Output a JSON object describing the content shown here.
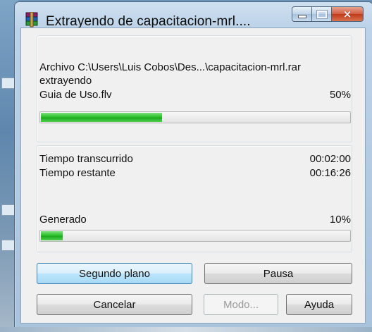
{
  "window": {
    "title": "Extrayendo de capacitacion-mrl....",
    "controls": {
      "minimize": "minimize-icon",
      "maximize": "maximize-icon",
      "close": "×"
    }
  },
  "extract": {
    "archive_line": "Archivo C:\\Users\\Luis Cobos\\Des...\\capacitacion-mrl.rar",
    "action": "extrayendo",
    "file_name": "Guia de Uso.flv",
    "file_percent": "50%",
    "file_progress": 0.39
  },
  "time": {
    "elapsed_label": "Tiempo transcurrido",
    "elapsed_value": "00:02:00",
    "remaining_label": "Tiempo restante",
    "remaining_value": "00:16:26"
  },
  "total": {
    "label": "Generado",
    "percent": "10%",
    "progress": 0.07
  },
  "buttons": {
    "background": "Segundo plano",
    "pause": "Pausa",
    "cancel": "Cancelar",
    "mode": "Modo...",
    "help": "Ayuda"
  },
  "colors": {
    "progress_fill": "#2bc22b",
    "focus_button": "#bee6fd",
    "window_frame": "#a9c3dc"
  }
}
